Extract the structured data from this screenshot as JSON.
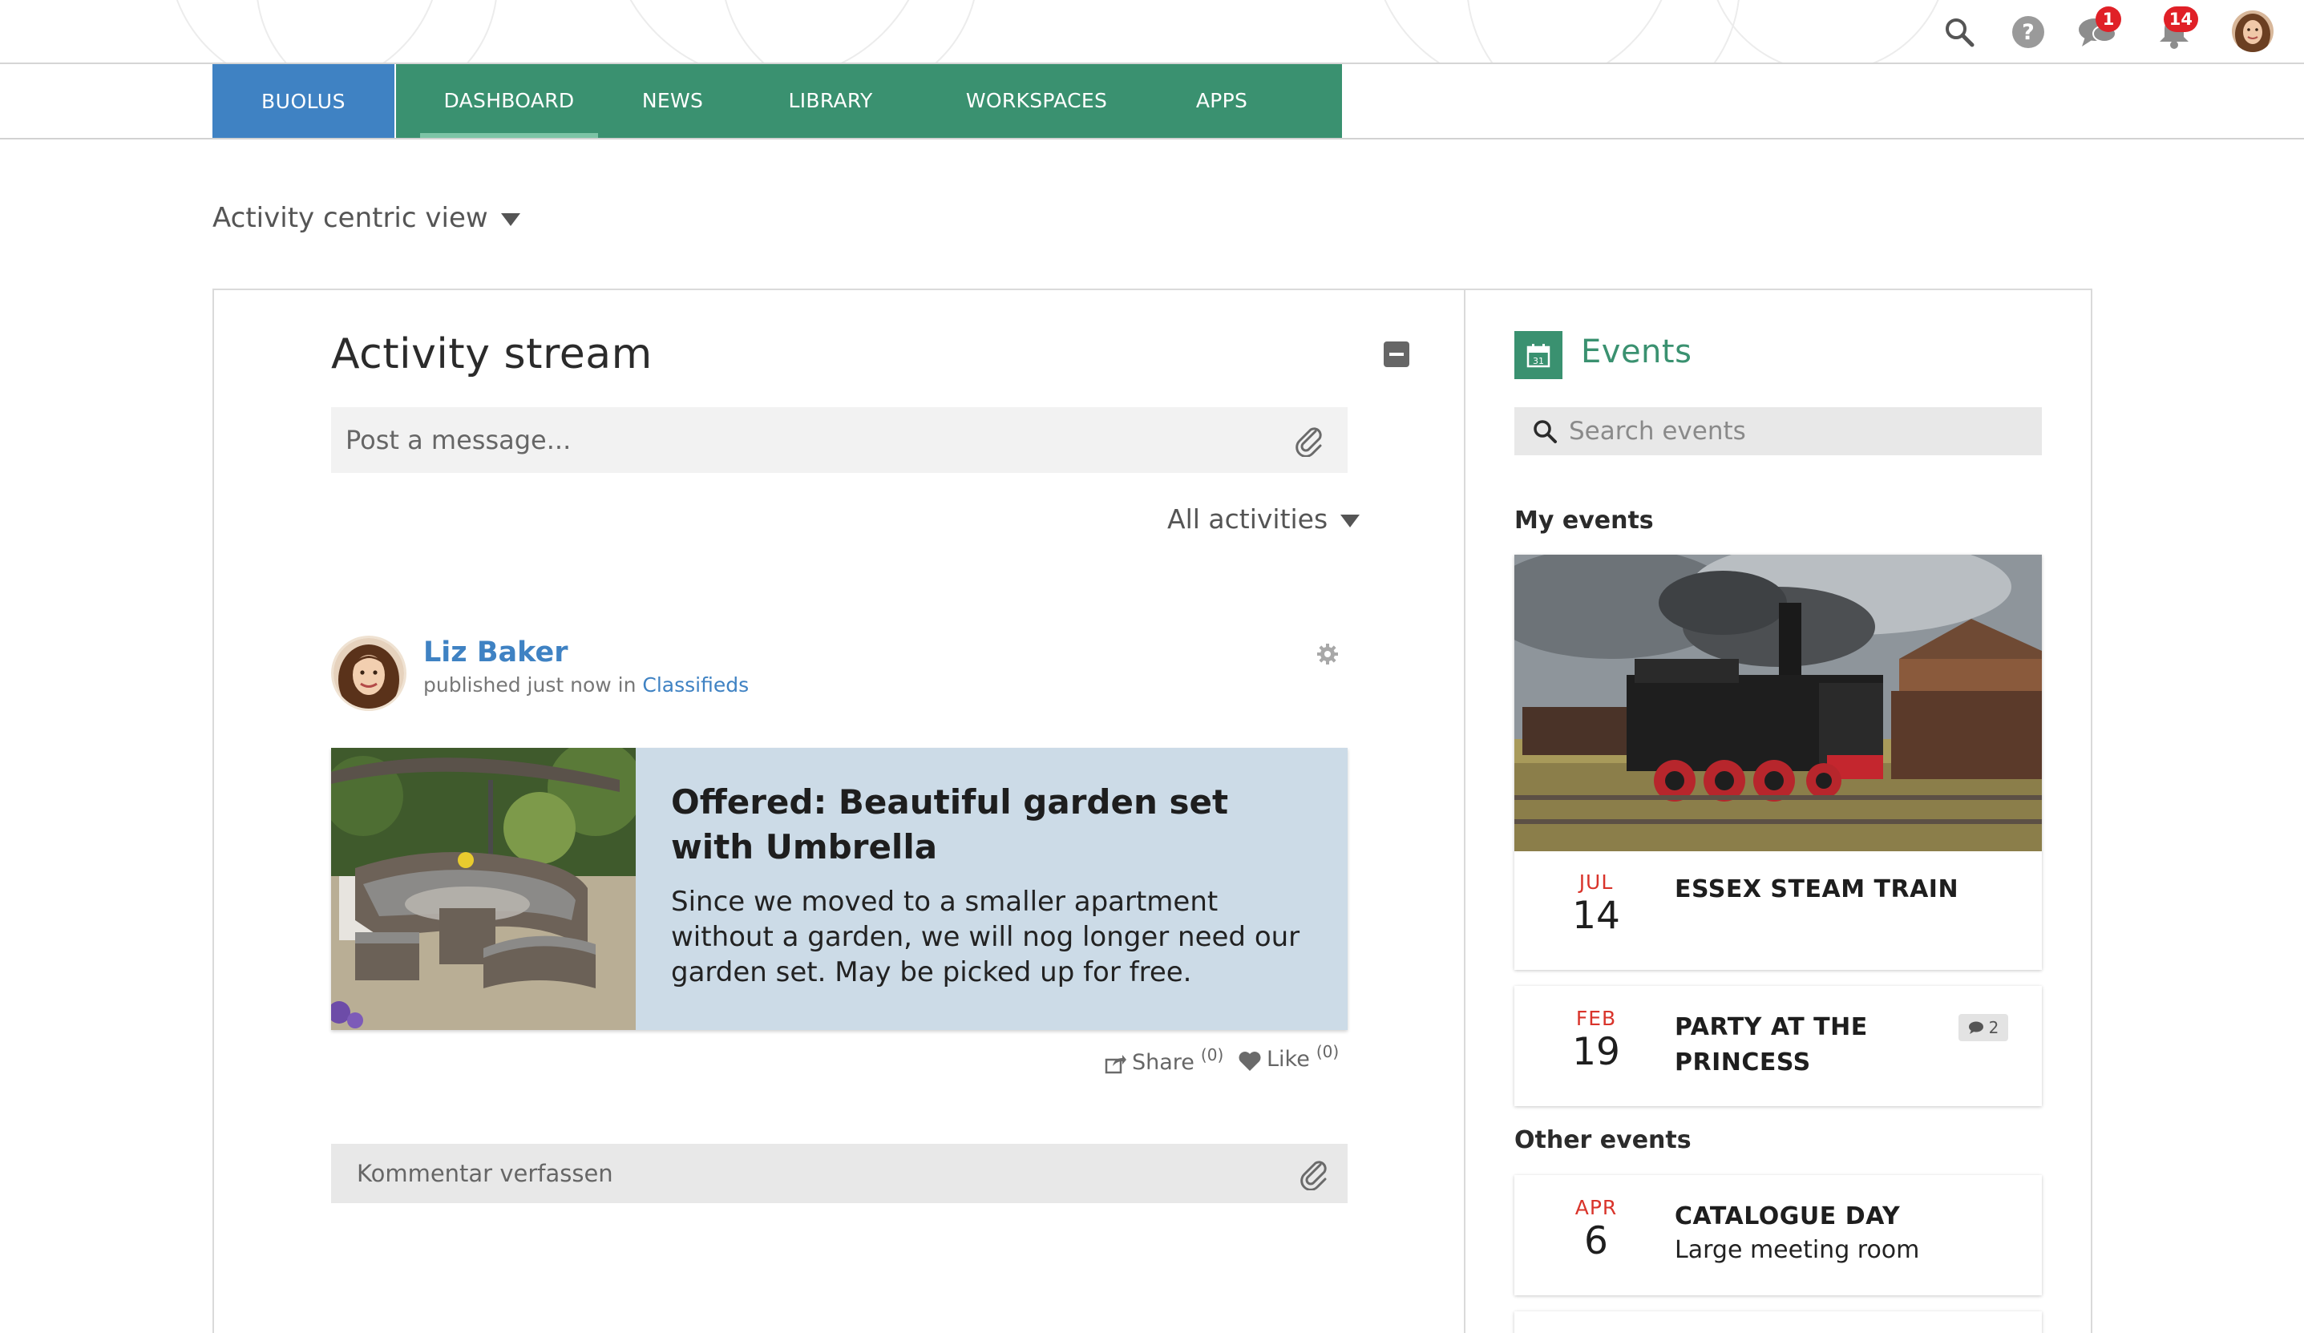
{
  "topbar": {
    "chat_badge": "1",
    "notif_badge": "14"
  },
  "nav": {
    "brand": "BUOLUS",
    "items": [
      "DASHBOARD",
      "NEWS",
      "LIBRARY",
      "WORKSPACES",
      "APPS"
    ],
    "active": "DASHBOARD"
  },
  "view_selector": "Activity centric view",
  "stream": {
    "title": "Activity stream",
    "post_placeholder": "Post a message...",
    "filter": "All activities",
    "post": {
      "author": "Liz Baker",
      "meta_prefix": "published just now in",
      "category": "Classifieds",
      "title": "Offered: Beautiful garden set with Umbrella",
      "text": "Since we moved to a smaller apartment without a garden, we will nog longer need our garden set. May be picked up for free.",
      "share_label": "Share",
      "share_count": "(0)",
      "like_label": "Like",
      "like_count": "(0)"
    },
    "comment_placeholder": "Kommentar verfassen"
  },
  "events": {
    "title": "Events",
    "calendar_day": "31",
    "search_placeholder": "Search events",
    "my_events_label": "My events",
    "other_events_label": "Other events",
    "my_events": [
      {
        "month": "JUL",
        "day": "14",
        "name": "ESSEX STEAM TRAIN"
      },
      {
        "month": "FEB",
        "day": "19",
        "name": "PARTY AT THE PRINCESS",
        "comments": "2"
      }
    ],
    "other_events": [
      {
        "month": "APR",
        "day": "6",
        "name": "CATALOGUE DAY",
        "location": "Large meeting room"
      }
    ]
  },
  "colors": {
    "brand_blue": "#3f82c3",
    "nav_green": "#3a9170",
    "event_month_red": "#d9342b",
    "card_blue": "#ccdbe7"
  }
}
